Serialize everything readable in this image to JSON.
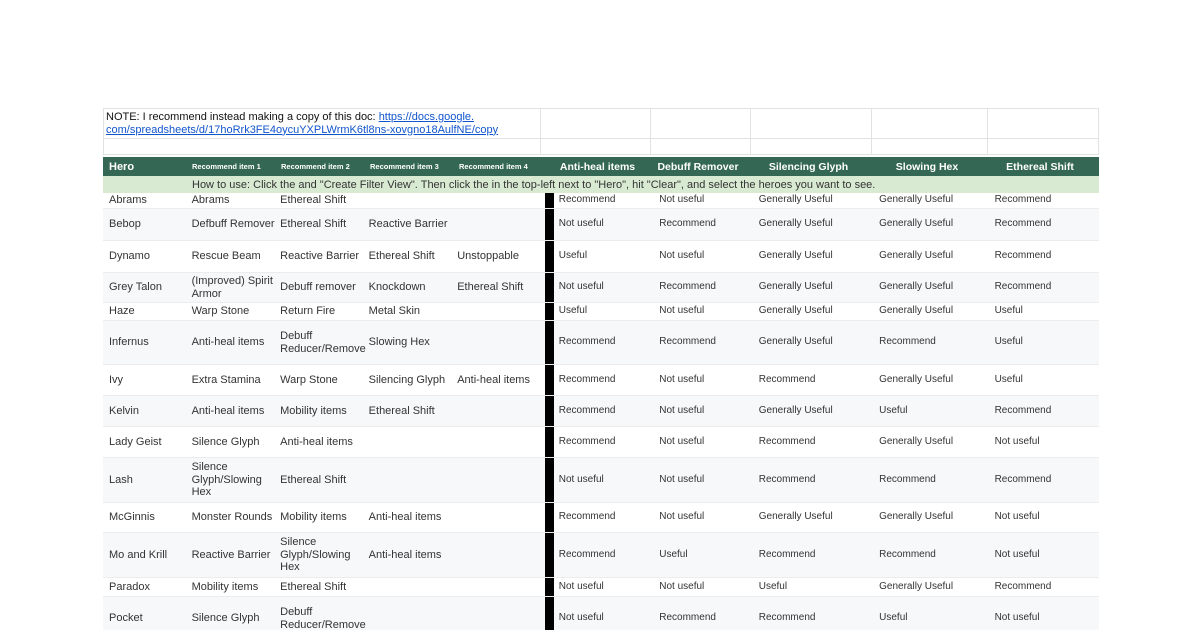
{
  "note": {
    "text": "NOTE: I recommend instead making a copy of this doc: ",
    "link": "https://docs.google.com/spreadsheets/d/17hoRrk3FE4oycuYXPLWrmK6tl8ns-xovgno18AulfNE/copy",
    "link_line1": "https://docs.google.",
    "link_line2": "com/spreadsheets/d/17hoRrk3FE4oycuYXPLWrmK6tl8ns-xovgno18AulfNE/copy"
  },
  "header": {
    "hero": "Hero",
    "rec1": "Recommend item 1",
    "rec2": "Recommend item 2",
    "rec3": "Recommend item 3",
    "rec4": "Recommend item 4",
    "antiheal": "Anti-heal items",
    "debuff": "Debuff Remover",
    "silencing": "Silencing Glyph",
    "slowing": "Slowing Hex",
    "ethereal": "Ethereal Shift"
  },
  "howto": "How to use: Click the  and \"Create Filter View\". Then click the  in the top-left next to \"Hero\", hit \"Clear\", and select the heroes you want to see.",
  "colors": {
    "header_bg": "#356854",
    "howto_bg": "#d9ead3",
    "recommend": "#2e8b57",
    "useful": "#1f4fd1"
  },
  "rows": [
    {
      "hero": "Abrams",
      "i1": "Abrams",
      "i2": "Ethereal Shift",
      "i3": "",
      "i4": "",
      "e1": "Recommend",
      "e2": "Not useful",
      "e3": "Generally Useful",
      "e4": "Generally Useful",
      "e5": "Recommend",
      "h": 16
    },
    {
      "hero": "Bebop",
      "i1": "Defbuff Remover",
      "i2": "Ethereal Shift",
      "i3": "Reactive Barrier",
      "i4": "",
      "e1": "Not useful",
      "e2": "Recommend",
      "e3": "Generally Useful",
      "e4": "Generally Useful",
      "e5": "Recommend",
      "h": 32
    },
    {
      "hero": "Dynamo",
      "i1": "Rescue Beam",
      "i2": "Reactive Barrier",
      "i3": "Ethereal Shift",
      "i4": "Unstoppable",
      "e1": "Useful",
      "e2": "Not useful",
      "e3": "Generally Useful",
      "e4": "Generally Useful",
      "e5": "Recommend",
      "h": 32
    },
    {
      "hero": "Grey Talon",
      "i1": "(Improved) Spirit Armor",
      "i2": "Debuff remover",
      "i3": "Knockdown",
      "i4": "Ethereal Shift",
      "e1": "Not useful",
      "e2": "Recommend",
      "e3": "Generally Useful",
      "e4": "Generally Useful",
      "e5": "Recommend",
      "h": 30
    },
    {
      "hero": "Haze",
      "i1": "Warp Stone",
      "i2": "Return Fire",
      "i3": "Metal Skin",
      "i4": "",
      "e1": "Useful",
      "e2": "Not useful",
      "e3": "Generally Useful",
      "e4": "Generally Useful",
      "e5": "Useful",
      "h": 18
    },
    {
      "hero": "Infernus",
      "i1": "Anti-heal items",
      "i2": "Debuff Reducer/Remover",
      "i3": "Slowing Hex",
      "i4": "",
      "e1": "Recommend",
      "e2": "Recommend",
      "e3": "Generally Useful",
      "e4": "Recommend",
      "e5": "Useful",
      "h": 44
    },
    {
      "hero": "Ivy",
      "i1": "Extra Stamina",
      "i2": "Warp Stone",
      "i3": "Silencing Glyph",
      "i4": "Anti-heal items",
      "e1": "Recommend",
      "e2": "Not useful",
      "e3": "Recommend",
      "e4": "Generally Useful",
      "e5": "Useful",
      "h": 31
    },
    {
      "hero": "Kelvin",
      "i1": "Anti-heal items",
      "i2": "Mobility items",
      "i3": "Ethereal Shift",
      "i4": "",
      "e1": "Recommend",
      "e2": "Not useful",
      "e3": "Generally Useful",
      "e4": "Useful",
      "e5": "Recommend",
      "h": 31
    },
    {
      "hero": "Lady Geist",
      "i1": "Silence Glyph",
      "i2": "Anti-heal items",
      "i3": "",
      "i4": "",
      "e1": "Recommend",
      "e2": "Not useful",
      "e3": "Recommend",
      "e4": "Generally Useful",
      "e5": "Not useful",
      "h": 31
    },
    {
      "hero": "Lash",
      "i1": "Silence Glyph/Slowing Hex",
      "i2": "Ethereal Shift",
      "i3": "",
      "i4": "",
      "e1": "Not useful",
      "e2": "Not useful",
      "e3": "Recommend",
      "e4": "Recommend",
      "e5": "Recommend",
      "h": 45
    },
    {
      "hero": "McGinnis",
      "i1": "Monster Rounds",
      "i2": "Mobility items",
      "i3": "Anti-heal items",
      "i4": "",
      "e1": "Recommend",
      "e2": "Not useful",
      "e3": "Generally Useful",
      "e4": "Generally Useful",
      "e5": "Not useful",
      "h": 30
    },
    {
      "hero": "Mo and Krill",
      "i1": "Reactive Barrier",
      "i2": "Silence Glyph/Slowing Hex",
      "i3": "Anti-heal items",
      "i4": "",
      "e1": "Recommend",
      "e2": "Useful",
      "e3": "Recommend",
      "e4": "Recommend",
      "e5": "Not useful",
      "h": 45
    },
    {
      "hero": "Paradox",
      "i1": "Mobility items",
      "i2": "Ethereal Shift",
      "i3": "",
      "i4": "",
      "e1": "Not useful",
      "e2": "Not useful",
      "e3": "Useful",
      "e4": "Generally Useful",
      "e5": "Recommend",
      "h": 19
    },
    {
      "hero": "Pocket",
      "i1": "Silence Glyph",
      "i2": "Debuff Reducer/Remover",
      "i3": "",
      "i4": "",
      "e1": "Not useful",
      "e2": "Recommend",
      "e3": "Recommend",
      "e4": "Useful",
      "e5": "Not useful",
      "h": 44
    }
  ]
}
